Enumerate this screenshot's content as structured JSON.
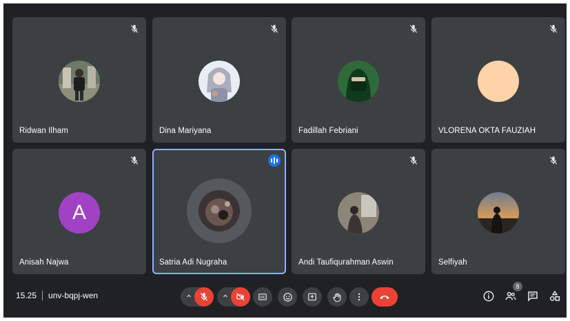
{
  "participants": [
    {
      "name": "Ridwan Ilham",
      "muted": true
    },
    {
      "name": "Dina Mariyana",
      "muted": true
    },
    {
      "name": "Fadillah Febriani",
      "muted": true
    },
    {
      "name": "VLORENA OKTA FAUZIAH",
      "muted": true
    },
    {
      "name": "Anisah Najwa",
      "muted": true,
      "avatar_letter": "A"
    },
    {
      "name": "Satria Adi Nugraha",
      "muted": false,
      "speaking": true
    },
    {
      "name": "Andi Taufiqurahman Aswin",
      "muted": true
    },
    {
      "name": "Selfiyah",
      "muted": true
    }
  ],
  "meeting": {
    "time": "15.25",
    "code": "unv-bqpj-wen"
  },
  "controls": [
    "mic-off",
    "camera-off",
    "captions",
    "emoji",
    "present",
    "raise-hand",
    "more",
    "leave-call"
  ],
  "right_controls": {
    "people_count": "8"
  },
  "colors": {
    "background": "#202124",
    "tile": "#3c4043",
    "speaking_border": "#8ab4f8",
    "danger": "#ea4335",
    "accent": "#1a73e8"
  }
}
